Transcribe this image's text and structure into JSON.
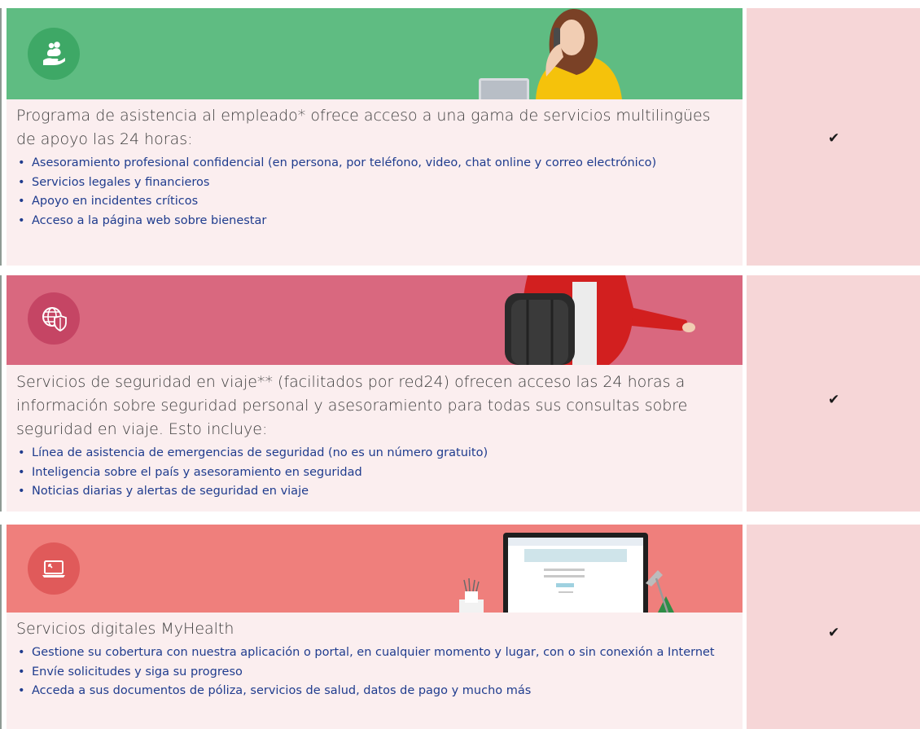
{
  "sections": [
    {
      "banner_color": "#5fbc82",
      "icon": "hand-people-icon",
      "intro": "Programa de asistencia al empleado* ofrece acceso a una gama de servicios multilingües de apoyo las 24 horas:",
      "items": [
        "Asesoramiento profesional confidencial (en persona, por teléfono, video, chat online y correo electrónico)",
        "Servicios legales y financieros",
        "Apoyo en incidentes críticos",
        "Acceso a la página web sobre bienestar"
      ],
      "included": "✔"
    },
    {
      "banner_color": "#d9687f",
      "icon": "globe-shield-icon",
      "intro": "Servicios de seguridad en viaje** (facilitados por red24) ofrecen acceso las 24 horas a información sobre seguridad personal y asesoramiento para todas sus consultas sobre seguridad en viaje. Esto incluye:",
      "items": [
        "Línea de asistencia de emergencias de seguridad (no es un número gratuito)",
        "Inteligencia sobre el país y asesoramiento en seguridad",
        "Noticias diarias y alertas de seguridad en viaje"
      ],
      "included": "✔"
    },
    {
      "banner_color": "#ef7f7c",
      "icon": "laptop-icon",
      "intro": "Servicios digitales MyHealth",
      "items": [
        "Gestione su cobertura con nuestra aplicación o portal, en cualquier momento y lugar, con o sin conexión a Internet",
        "Envíe solicitudes y siga su progreso",
        "Acceda a sus documentos de póliza, servicios de salud, datos de pago y mucho más"
      ],
      "included": "✔"
    }
  ]
}
